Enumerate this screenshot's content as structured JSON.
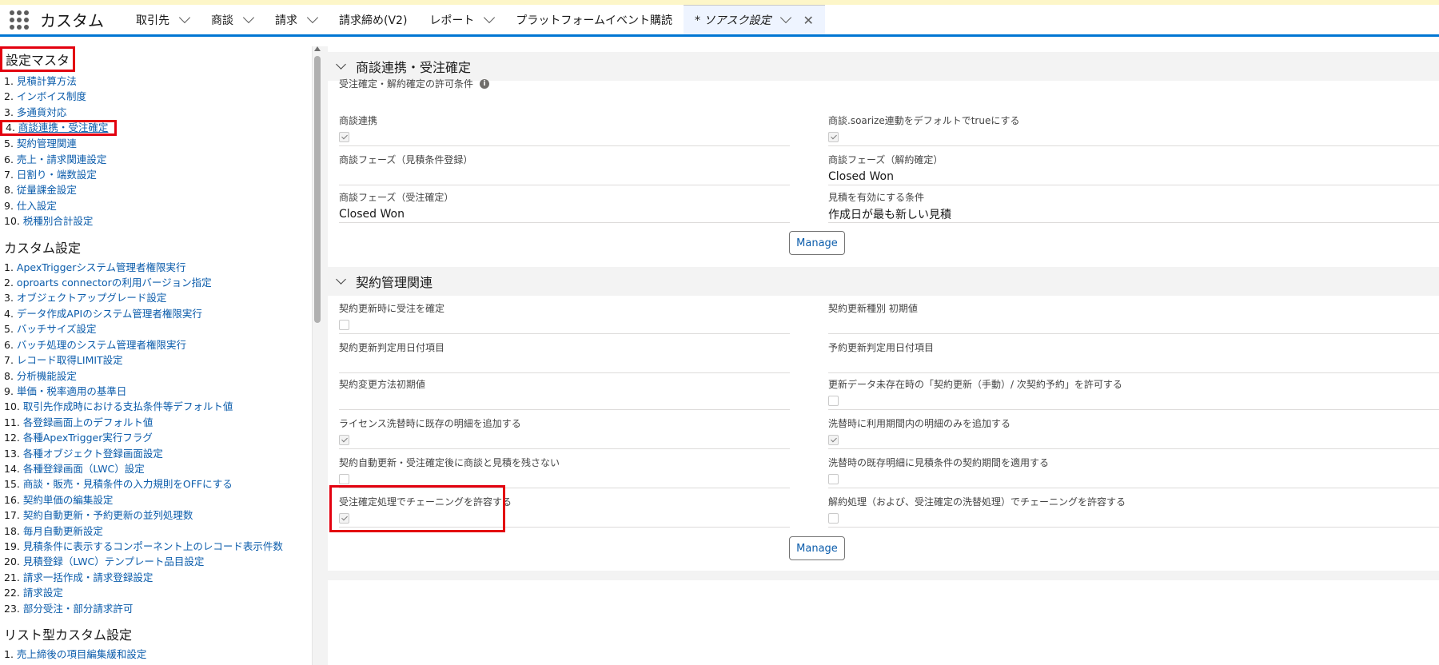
{
  "app": {
    "name": "カスタム"
  },
  "tabs": [
    {
      "label": "取引先",
      "has_menu": true
    },
    {
      "label": "商談",
      "has_menu": true
    },
    {
      "label": "請求",
      "has_menu": true
    },
    {
      "label": "請求締め(V2)",
      "has_menu": false
    },
    {
      "label": "レポート",
      "has_menu": true
    },
    {
      "label": "プラットフォームイベント購読",
      "has_menu": false
    },
    {
      "label": "* ソアスク設定",
      "has_menu": true,
      "active": true,
      "closable": true
    }
  ],
  "sidebar": {
    "master_heading": "設定マスタ",
    "master_items": [
      {
        "num": "1.",
        "label": "見積計算方法"
      },
      {
        "num": "2.",
        "label": "インボイス制度"
      },
      {
        "num": "3.",
        "label": "多通貨対応"
      },
      {
        "num": "4.",
        "label": "商談連携・受注確定"
      },
      {
        "num": "5.",
        "label": "契約管理関連"
      },
      {
        "num": "6.",
        "label": "売上・請求関連設定"
      },
      {
        "num": "7.",
        "label": "日割り・端数設定"
      },
      {
        "num": "8.",
        "label": "従量課金設定"
      },
      {
        "num": "9.",
        "label": "仕入設定"
      },
      {
        "num": "10.",
        "label": "税種別合計設定"
      }
    ],
    "custom_heading": "カスタム設定",
    "custom_items": [
      {
        "num": "1.",
        "label": "ApexTriggerシステム管理者権限実行"
      },
      {
        "num": "2.",
        "label": "oproarts connectorの利用バージョン指定"
      },
      {
        "num": "3.",
        "label": "オブジェクトアップグレード設定"
      },
      {
        "num": "4.",
        "label": "データ作成APIのシステム管理者権限実行"
      },
      {
        "num": "5.",
        "label": "バッチサイズ設定"
      },
      {
        "num": "6.",
        "label": "バッチ処理のシステム管理者権限実行"
      },
      {
        "num": "7.",
        "label": "レコード取得LIMIT設定"
      },
      {
        "num": "8.",
        "label": "分析機能設定"
      },
      {
        "num": "9.",
        "label": "単価・税率適用の基準日"
      },
      {
        "num": "10.",
        "label": "取引先作成時における支払条件等デフォルト値"
      },
      {
        "num": "11.",
        "label": "各登録画面上のデフォルト値"
      },
      {
        "num": "12.",
        "label": "各種ApexTrigger実行フラグ"
      },
      {
        "num": "13.",
        "label": "各種オブジェクト登録画面設定"
      },
      {
        "num": "14.",
        "label": "各種登録画面（LWC）設定"
      },
      {
        "num": "15.",
        "label": "商談・販売・見積条件の入力規則をOFFにする"
      },
      {
        "num": "16.",
        "label": "契約単価の編集設定"
      },
      {
        "num": "17.",
        "label": "契約自動更新・予約更新の並列処理数"
      },
      {
        "num": "18.",
        "label": "毎月自動更新設定"
      },
      {
        "num": "19.",
        "label": "見積条件に表示するコンポーネント上のレコード表示件数"
      },
      {
        "num": "20.",
        "label": "見積登録（LWC）テンプレート品目設定"
      },
      {
        "num": "21.",
        "label": "請求一括作成・請求登録設定"
      },
      {
        "num": "22.",
        "label": "請求設定"
      },
      {
        "num": "23.",
        "label": "部分受注・部分請求許可"
      }
    ],
    "list_heading": "リスト型カスタム設定",
    "list_items": [
      {
        "num": "1.",
        "label": "売上締後の項目編集緩和設定"
      }
    ]
  },
  "section1": {
    "title": "商談連携・受注確定",
    "permit_label": "受注確定・解約確定の許可条件",
    "fields": {
      "deal_link": {
        "label": "商談連携",
        "checked": true
      },
      "soarize_default": {
        "label": "商談.soarize連動をデフォルトでtrueにする",
        "checked": true
      },
      "phase_quote": {
        "label": "商談フェーズ（見積条件登録）",
        "value": ""
      },
      "phase_cancel": {
        "label": "商談フェーズ（解約確定）",
        "value": "Closed Won"
      },
      "phase_order": {
        "label": "商談フェーズ（受注確定）",
        "value": "Closed Won"
      },
      "quote_valid": {
        "label": "見積を有効にする条件",
        "value": "作成日が最も新しい見積"
      }
    },
    "manage_label": "Manage"
  },
  "section2": {
    "title": "契約管理関連",
    "fields": {
      "renew_confirm": {
        "label": "契約更新時に受注を確定",
        "checked": false
      },
      "renew_type": {
        "label": "契約更新種別 初期値",
        "value": ""
      },
      "renew_date_item": {
        "label": "契約更新判定用日付項目",
        "value": ""
      },
      "reserve_date_item": {
        "label": "予約更新判定用日付項目",
        "value": ""
      },
      "change_method": {
        "label": "契約変更方法初期値",
        "value": ""
      },
      "no_data_permit": {
        "label": "更新データ未存在時の「契約更新（手動）/ 次契約予約」を許可する",
        "checked": false
      },
      "license_add": {
        "label": "ライセンス洗替時に既存の明細を追加する",
        "checked": true
      },
      "period_only": {
        "label": "洗替時に利用期間内の明細のみを追加する",
        "checked": true
      },
      "no_keep": {
        "label": "契約自動更新・受注確定後に商談と見積を残さない",
        "checked": false
      },
      "apply_period": {
        "label": "洗替時の既存明細に見積条件の契約期間を適用する",
        "checked": false
      },
      "chaining_order": {
        "label": "受注確定処理でチェーニングを許容する",
        "checked": true
      },
      "chaining_cancel": {
        "label": "解約処理（および、受注確定の洗替処理）でチェーニングを許容する",
        "checked": false
      }
    },
    "manage_label": "Manage"
  },
  "colors": {
    "accent": "#0176d3",
    "link": "#0b5cab",
    "highlight": "#e3000f"
  }
}
